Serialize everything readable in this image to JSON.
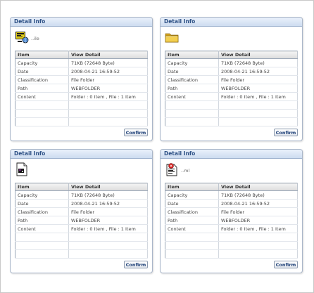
{
  "panels": [
    {
      "title": "Detail Info",
      "icon": "web-application-icon",
      "file_name": "..ile",
      "columns": [
        "Item",
        "View Detail"
      ],
      "rows": [
        {
          "item": "Capacity",
          "value": "71KB (72648 Byte)"
        },
        {
          "item": "Date",
          "value": "2008-04-21 16:59:52"
        },
        {
          "item": "Classification",
          "value": "File Folder"
        },
        {
          "item": "Path",
          "value": "WEBFOLDER"
        },
        {
          "item": "Content",
          "value": "Folder : 0 Item , File : 1 Item"
        }
      ],
      "confirm_label": "Confirm"
    },
    {
      "title": "Detail Info",
      "icon": "folder-icon",
      "file_name": "",
      "columns": [
        "Item",
        "View Detail"
      ],
      "rows": [
        {
          "item": "Capacity",
          "value": "71KB (72648 Byte)"
        },
        {
          "item": "Date",
          "value": "2008-04-21 16:59:52"
        },
        {
          "item": "Classification",
          "value": "File Folder"
        },
        {
          "item": "Path",
          "value": "WEBFOLDER"
        },
        {
          "item": "Content",
          "value": "Folder : 0 Item , File : 1 Item"
        }
      ],
      "confirm_label": "Confirm"
    },
    {
      "title": "Detail Info",
      "icon": "document-icon",
      "file_name": "",
      "columns": [
        "Item",
        "View Detail"
      ],
      "rows": [
        {
          "item": "Capacity",
          "value": "71KB (72648 Byte)"
        },
        {
          "item": "Date",
          "value": "2008-04-21 16:59:52"
        },
        {
          "item": "Classification",
          "value": "File Folder"
        },
        {
          "item": "Path",
          "value": "WEBFOLDER"
        },
        {
          "item": "Content",
          "value": "Folder : 0 Item , File : 1 Item"
        }
      ],
      "confirm_label": "Confirm"
    },
    {
      "title": "Detail Info",
      "icon": "document-error-icon",
      "file_name": "..ml",
      "columns": [
        "Item",
        "View Detail"
      ],
      "rows": [
        {
          "item": "Capacity",
          "value": "71KB (72648 Byte)"
        },
        {
          "item": "Date",
          "value": "2008-04-21 16:59:52"
        },
        {
          "item": "Classification",
          "value": "File Folder"
        },
        {
          "item": "Path",
          "value": "WEBFOLDER"
        },
        {
          "item": "Content",
          "value": "Folder : 0 Item , File : 1 Item"
        }
      ],
      "confirm_label": "Confirm"
    }
  ]
}
